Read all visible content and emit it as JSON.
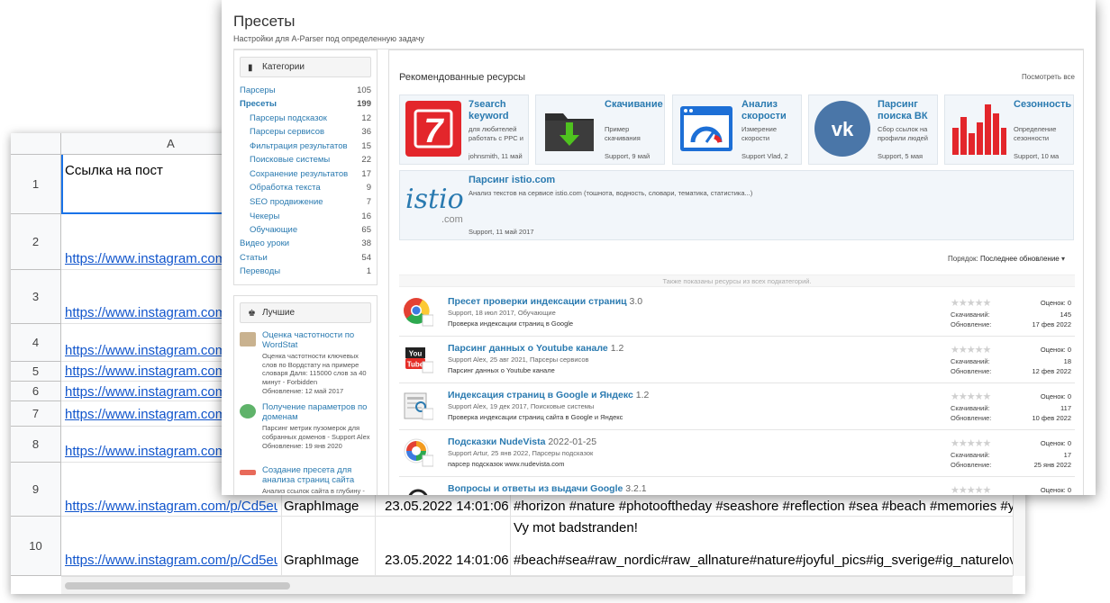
{
  "sheet": {
    "col_a": "A",
    "rows": [
      {
        "num": "1",
        "a": "Ссылка на пост"
      },
      {
        "num": "2",
        "a": "https://www.instagram.com"
      },
      {
        "num": "3",
        "a": "https://www.instagram.com"
      },
      {
        "num": "4",
        "a": "https://www.instagram.com"
      },
      {
        "num": "5",
        "a": "https://www.instagram.com"
      },
      {
        "num": "6",
        "a": "https://www.instagram.com"
      },
      {
        "num": "7",
        "a": "https://www.instagram.com"
      },
      {
        "num": "8",
        "a": "https://www.instagram.com"
      },
      {
        "num": "9",
        "a": "https://www.instagram.com/p/Cd5eu",
        "b": "GraphImage",
        "c": "23.05.2022 14:01:06",
        "d": "#horizon #nature #photooftheday #seashore #reflection #sea #beach #memories #y"
      },
      {
        "num": "10",
        "a": "https://www.instagram.com/p/Cd5eu",
        "b": "GraphImage",
        "c": "23.05.2022 14:01:06",
        "d_line1": "Vy mot badstranden!",
        "d": "#beach#sea#raw_nordic#raw_allnature#nature#joyful_pics#ig_sverige#ig_naturelov"
      }
    ]
  },
  "aparser": {
    "title": "Пресеты",
    "subtitle": "Настройки для A-Parser под определенную задачу",
    "categories": {
      "header": "Категории",
      "items": [
        {
          "label": "Парсеры",
          "count": "105"
        },
        {
          "label": "Пресеты",
          "count": "199"
        },
        {
          "label": "Парсеры подсказок",
          "count": "12"
        },
        {
          "label": "Парсеры сервисов",
          "count": "36"
        },
        {
          "label": "Фильтрация результатов",
          "count": "15"
        },
        {
          "label": "Поисковые системы",
          "count": "22"
        },
        {
          "label": "Сохранение результатов",
          "count": "17"
        },
        {
          "label": "Обработка текста",
          "count": "9"
        },
        {
          "label": "SEO продвижение",
          "count": "7"
        },
        {
          "label": "Чекеры",
          "count": "16"
        },
        {
          "label": "Обучающие",
          "count": "65"
        },
        {
          "label": "Видео уроки",
          "count": "38"
        },
        {
          "label": "Статьи",
          "count": "54"
        },
        {
          "label": "Переводы",
          "count": "1"
        }
      ]
    },
    "best": {
      "header": "Лучшие",
      "items": [
        {
          "title": "Оценка частотности по WordStat",
          "desc": "Оценка частотности ключевых слов по Вордстату на примере словаря Даля: 115000 слов за 40 минут - Forbidden",
          "updated": "Обновление: 12 май 2017"
        },
        {
          "title": "Получение параметров по доменам",
          "desc": "Парсинг метрик пузомерок для собранных доменов - Support Alex",
          "updated": "Обновление: 19 янв 2020"
        },
        {
          "title": "Создание пресета для анализа страниц сайта",
          "desc": "Анализ ссылок сайта в глубину -",
          "updated": ""
        }
      ]
    },
    "recommended": {
      "title": "Рекомендованные ресурсы",
      "see_all": "Посмотреть все",
      "cards": [
        {
          "title": "7search keyword",
          "desc": "для любителей работать с PPC и",
          "meta": "johnsmith, 11 май",
          "color": "#e3262b"
        },
        {
          "title": "Скачивание",
          "desc": "Пример скачивания",
          "meta": "Support, 9 май",
          "color": "#2f2f2f"
        },
        {
          "title": "Анализ скорости",
          "desc": "Измерение скорости",
          "meta": "Support Vlad, 2",
          "color": "#1d6fd6"
        },
        {
          "title": "Парсинг поиска ВК",
          "desc": "Сбор ссылок на профили людей",
          "meta": "Support, 5 мая",
          "color": "#4a76a8"
        },
        {
          "title": "Сезонность",
          "desc": "Определение сезонности",
          "meta": "Support, 10 ма",
          "color": "#e3262b"
        }
      ],
      "wide": {
        "title": "Парсинг istio.com",
        "desc": "Анализ текстов на сервисе istio.com (тошнота, водность, словари, тематика, статистика...)",
        "meta": "Support, 11 май 2017",
        "logo": "istio",
        "logo_sub": ".com"
      }
    },
    "order_label": "Порядок:",
    "order_value": "Последнее обновление",
    "note": "Также показаны ресурсы из всех подкатегорий.",
    "resources": [
      {
        "title": "Пресет проверки индексации страниц",
        "version": "3.0",
        "meta": "Support, 18 июл 2017, Обучающие",
        "desc": "Проверка индексации страниц в Google",
        "ratings": "Оценок: 0",
        "downloads": "145",
        "updated": "17 фев 2022"
      },
      {
        "title": "Парсинг данных о Youtube канале",
        "version": "1.2",
        "meta": "Support Alex, 25 авг 2021, Парсеры сервисов",
        "desc": "Парсинг данных о Youtube канале",
        "ratings": "Оценок: 0",
        "downloads": "18",
        "updated": "12 фев 2022"
      },
      {
        "title": "Индексация страниц в Google и Яндекс",
        "version": "1.2",
        "meta": "Support Alex, 19 дек 2017, Поисковые системы",
        "desc": "Проверка индексации страниц сайта в Google и Яндекс",
        "ratings": "Оценок: 0",
        "downloads": "117",
        "updated": "10 фев 2022"
      },
      {
        "title": "Подсказки NudeVista",
        "version": "2022-01-25",
        "meta": "Support Artur, 25 янв 2022, Парсеры подсказок",
        "desc": "парсер подсказок www.nudevista.com",
        "ratings": "Оценок: 0",
        "downloads": "17",
        "updated": "25 янв 2022"
      },
      {
        "title": "Вопросы и ответы из выдачи Google",
        "version": "3.2.1",
        "meta": "",
        "desc": "",
        "ratings": "Оценок: 0",
        "downloads": "",
        "updated": ""
      }
    ],
    "downloads_label": "Скачиваний:",
    "updated_label": "Обновление:"
  }
}
